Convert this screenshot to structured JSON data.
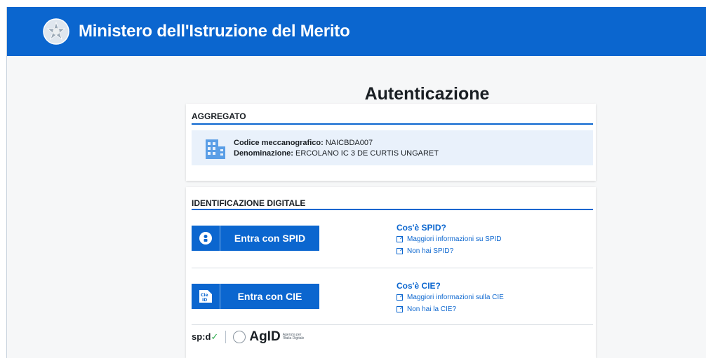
{
  "header": {
    "ministry_name": "Ministero dell'Istruzione del Merito",
    "bg_color": "#0b66cf"
  },
  "page": {
    "title": "Autenticazione"
  },
  "aggregato": {
    "section_title": "AGGREGATO",
    "icon": "building-icon",
    "codice_label": "Codice meccanografico:",
    "codice_value": "NAICBDA007",
    "denominazione_label": "Denominazione:",
    "denominazione_value": "ERCOLANO IC 3 DE CURTIS UNGARET"
  },
  "identificazione": {
    "section_title": "IDENTIFICAZIONE DIGITALE",
    "spid": {
      "button_label": "Entra con SPID",
      "icon": "spid-user-icon",
      "info_title": "Cos'è SPID?",
      "link_more": "Maggiori informazioni su SPID",
      "link_no": "Non hai SPID?"
    },
    "cie": {
      "button_label": "Entra con CIE",
      "icon": "cie-id-icon",
      "info_title": "Cos'è CIE?",
      "link_more": "Maggiori informazioni sulla CIE",
      "link_no": "Non hai la CIE?"
    },
    "footer_logos": {
      "spid_text": "sp:d",
      "agid_text": "AgID",
      "agid_sub": "Agenzia per l'Italia Digitale"
    }
  }
}
